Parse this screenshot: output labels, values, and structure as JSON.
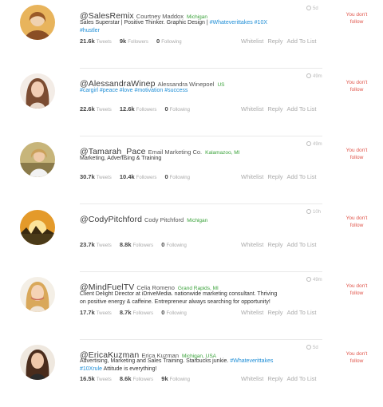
{
  "labels": {
    "tweets": "Tweets",
    "followers": "Followers",
    "following": "Following"
  },
  "actions": {
    "whitelist": "Whitelist",
    "reply": "Reply",
    "add_to_list": "Add To List"
  },
  "users": [
    {
      "handle": "@SalesRemix",
      "name": "Courtney Maddox",
      "location": "Michigan",
      "time": "5d",
      "bio1": "Sales Superstar | Positive Thinker. Graphic Design | ",
      "bio1_tags": "#Whateverittakes #10X",
      "bio2": "",
      "bio2_tags": "#hustler",
      "tweets": "21.6k",
      "followers": "9k",
      "following": "0",
      "status": "You don't follow",
      "avatar_color": "#c98a3a"
    },
    {
      "handle": "@AlessandraWinep",
      "name": "Alessandra Winepoel",
      "location": "US",
      "time": "49m",
      "bio1": "",
      "bio1_tags": "#cargirl #peace #love #motivation #success",
      "bio2": "",
      "bio2_tags": "",
      "tweets": "22.6k",
      "followers": "12.6k",
      "following": "0",
      "status": "You don't follow",
      "avatar_color": "#b98568"
    },
    {
      "handle": "@Tamarah_Pace",
      "name": "Email Marketing Co.",
      "location": "Kalamazoo, MI",
      "time": "49m",
      "bio1": "Marketing, Advertising & Training",
      "bio1_tags": "",
      "bio2": "",
      "bio2_tags": "",
      "tweets": "30.7k",
      "followers": "10.4k",
      "following": "0",
      "status": "You don't follow",
      "avatar_color": "#a98a52"
    },
    {
      "handle": "@CodyPitchford",
      "name": "Cody Pitchford",
      "location": "Michigan",
      "time": "10h",
      "bio1": "",
      "bio1_tags": "",
      "bio2": "",
      "bio2_tags": "",
      "tweets": "23.7k",
      "followers": "8.8k",
      "following": "0",
      "status": "You don't follow",
      "avatar_color": "#d58b1f"
    },
    {
      "handle": "@MindFuelTV",
      "name": "Celia Romeno",
      "location": "Grand Rapids, MI",
      "time": "49m",
      "bio1": "Client Delight Director at iDriveMedia. nationwide marketing consultant. Thriving",
      "bio1_tags": "",
      "bio2": "on positive energy & caffeine. Entrepreneur always searching for opportunity!",
      "bio2_tags": "",
      "tweets": "17.7k",
      "followers": "8.7k",
      "following": "0",
      "status": "You don't follow",
      "avatar_color": "#d9b07a"
    },
    {
      "handle": "@EricaKuzman",
      "name": "Erica Kuzman",
      "location": "Michigan, USA",
      "time": "5d",
      "bio1": "Advertising, Marketing and Sales Training. Starbucks junkie. ",
      "bio1_tags": "#Whateverittakes",
      "bio2": "",
      "bio2_tags": "#10Xrule",
      "bio2_after": " Attitude is everything!",
      "tweets": "16.5k",
      "followers": "8.6k",
      "following": "9k",
      "status": "You don't follow",
      "avatar_color": "#7a4a2f"
    }
  ]
}
